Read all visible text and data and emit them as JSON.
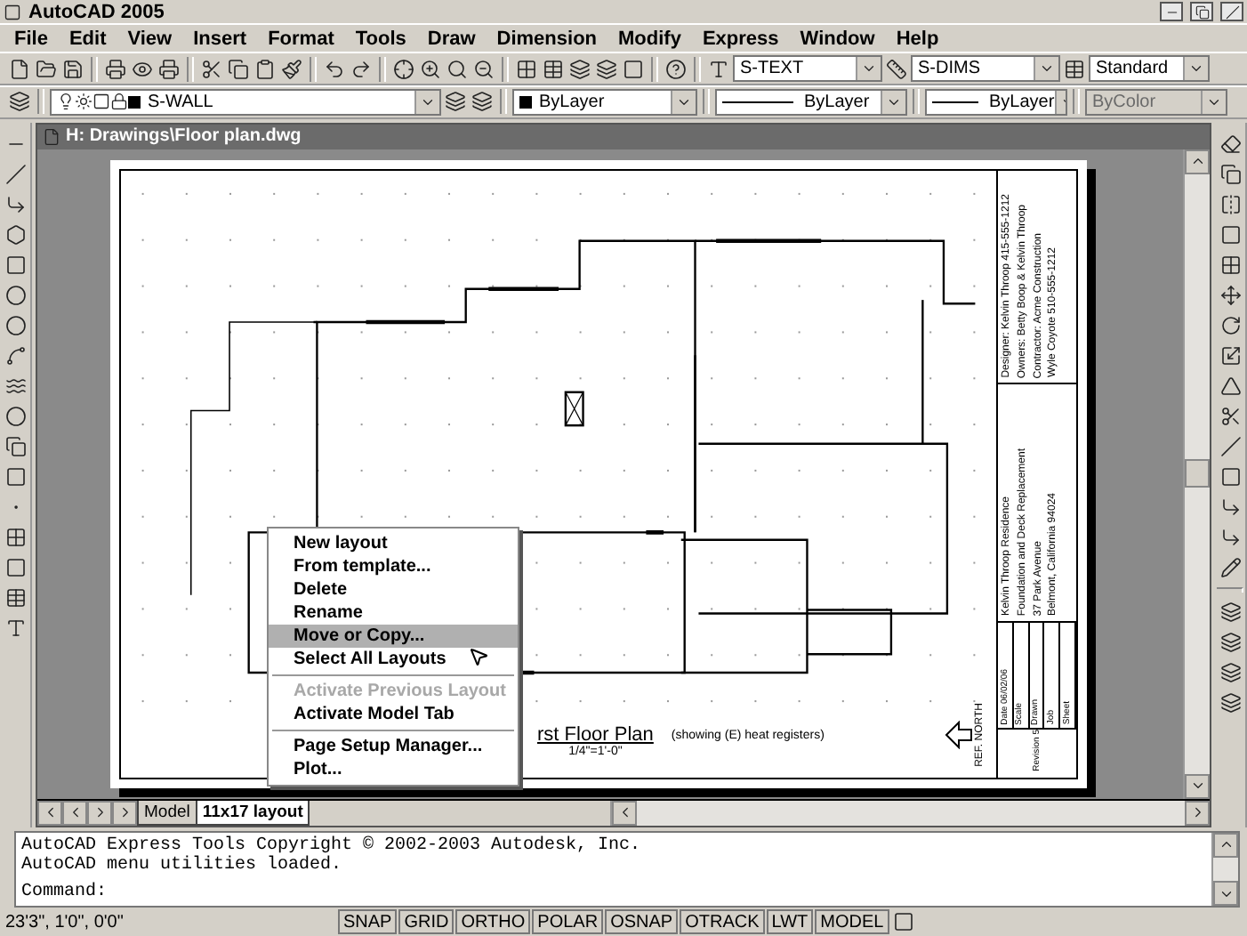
{
  "window": {
    "title": "AutoCAD 2005"
  },
  "menu": [
    "File",
    "Edit",
    "View",
    "Insert",
    "Format",
    "Tools",
    "Draw",
    "Dimension",
    "Modify",
    "Express",
    "Window",
    "Help"
  ],
  "styles": {
    "text_style": "S-TEXT",
    "dim_style": "S-DIMS",
    "table_style": "Standard"
  },
  "properties": {
    "layer": "S-WALL",
    "color_setting": "ByLayer",
    "linetype": "ByLayer",
    "lineweight": "ByLayer",
    "plot_style": "ByColor",
    "plot_style_disabled": true
  },
  "drawing_window": {
    "title": "H: Drawings\\Floor plan.dwg"
  },
  "plan": {
    "title": "rst Floor Plan",
    "note": "(showing (E) heat registers)",
    "scale": "1/4\"=1'-0\"",
    "north_label": "REF. NORTH"
  },
  "title_block": {
    "contacts": [
      "Designer:  Kelvin Throop   415-555-1212",
      "Owners:  Betty Boop & Kelvin Throop",
      "Contractor:  Acme Construction",
      "Wyle Coyote   510-555-1212"
    ],
    "project": [
      "Kelvin Throop Residence",
      "Foundation and Deck Replacement",
      "37 Park Avenue",
      "Belmont, California 94024"
    ],
    "fields": [
      "Date 06/02/06",
      "Scale",
      "Drawn",
      "Job",
      "Sheet"
    ],
    "revision": "Revision 5"
  },
  "layout_tabs": [
    {
      "label": "Model",
      "selected": false
    },
    {
      "label": "11x17 layout",
      "selected": true
    }
  ],
  "context_menu": [
    {
      "kind": "item",
      "label": "New layout",
      "disabled": false,
      "selected": false
    },
    {
      "kind": "item",
      "label": "From template...",
      "disabled": false,
      "selected": false
    },
    {
      "kind": "item",
      "label": "Delete",
      "disabled": false,
      "selected": false
    },
    {
      "kind": "item",
      "label": "Rename",
      "disabled": false,
      "selected": false
    },
    {
      "kind": "item",
      "label": "Move or Copy...",
      "disabled": false,
      "selected": true
    },
    {
      "kind": "item",
      "label": "Select All Layouts",
      "disabled": false,
      "selected": false
    },
    {
      "kind": "separator"
    },
    {
      "kind": "item",
      "label": "Activate Previous Layout",
      "disabled": true,
      "selected": false
    },
    {
      "kind": "item",
      "label": "Activate Model Tab",
      "disabled": false,
      "selected": false
    },
    {
      "kind": "separator"
    },
    {
      "kind": "item",
      "label": "Page Setup Manager...",
      "disabled": false,
      "selected": false
    },
    {
      "kind": "item",
      "label": "Plot...",
      "disabled": false,
      "selected": false
    }
  ],
  "command_window": {
    "lines": [
      "AutoCAD Express Tools Copyright © 2002-2003 Autodesk, Inc.",
      "AutoCAD menu utilities loaded."
    ],
    "prompt": "Command:"
  },
  "status_bar": {
    "coordinates": "23'3\", 1'0\", 0'0\"",
    "toggles": [
      "SNAP",
      "GRID",
      "ORTHO",
      "POLAR",
      "OSNAP",
      "OTRACK",
      "LWT",
      "MODEL"
    ]
  }
}
